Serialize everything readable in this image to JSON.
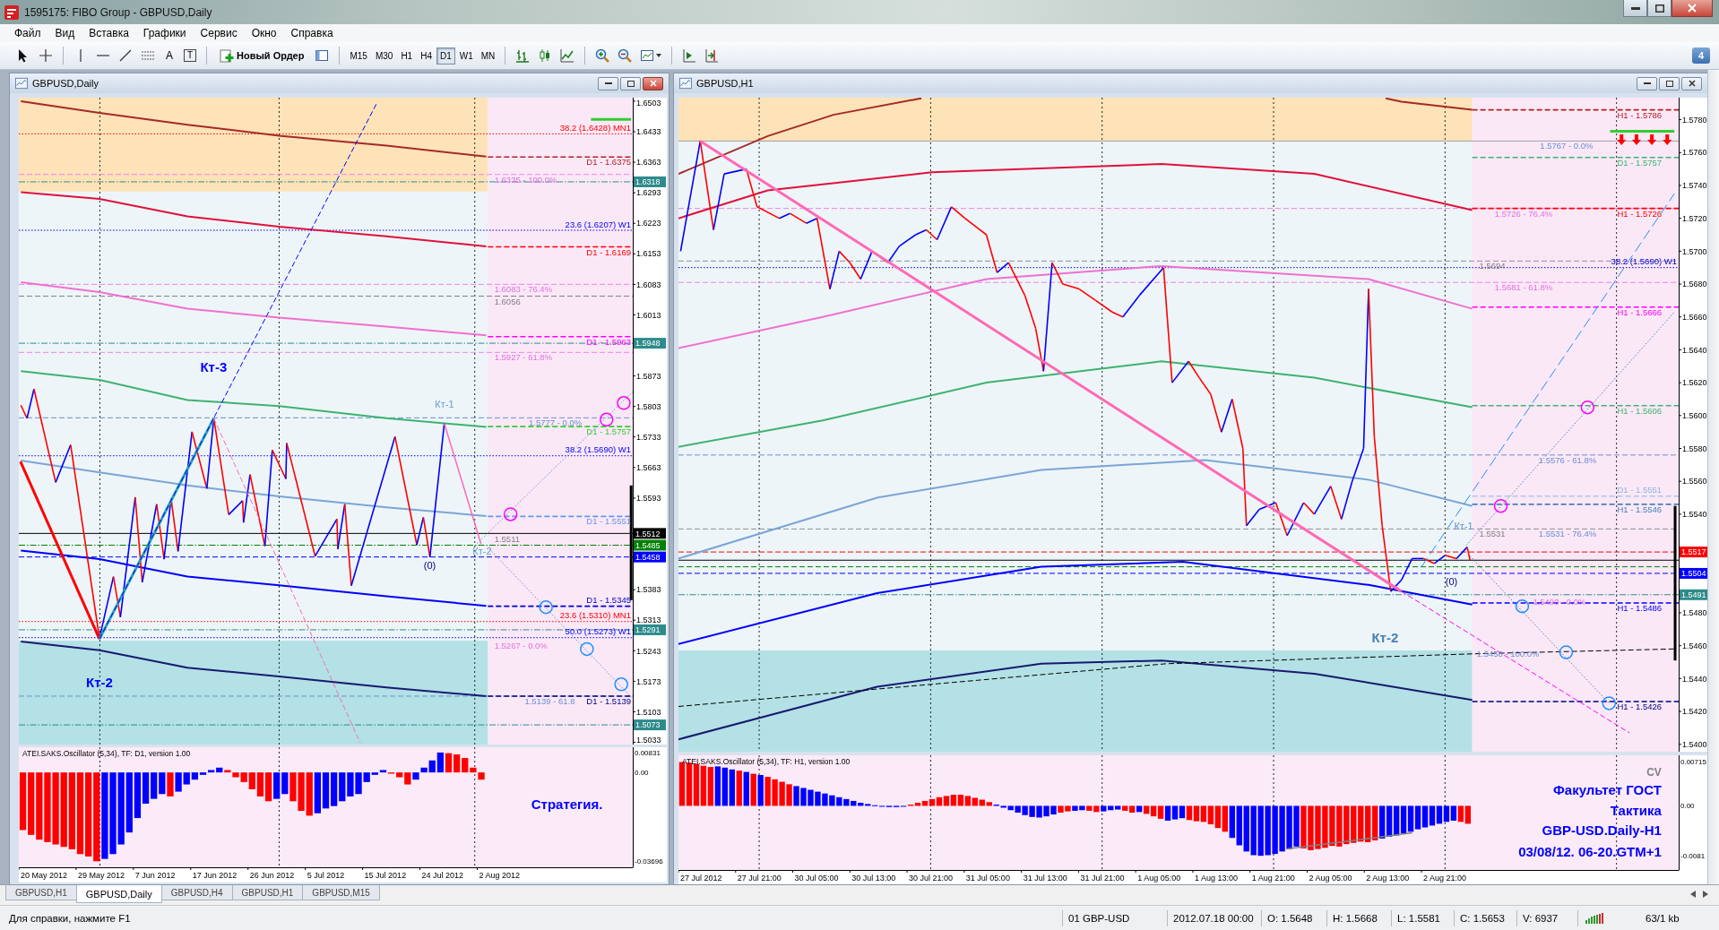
{
  "window": {
    "title": "1595175: FIBO Group - GBPUSD,Daily"
  },
  "menu": [
    "Файл",
    "Вид",
    "Вставка",
    "Графики",
    "Сервис",
    "Окно",
    "Справка"
  ],
  "toolbar": {
    "text_tools": [
      {
        "glyph": "A",
        "kind": "text"
      },
      {
        "glyph": "T",
        "kind": "label"
      }
    ],
    "new_order": "Новый Ордер",
    "timeframes": [
      {
        "label": "M15",
        "selected": false
      },
      {
        "label": "M30",
        "selected": false
      },
      {
        "label": "H1",
        "selected": false
      },
      {
        "label": "H4",
        "selected": false
      },
      {
        "label": "D1",
        "selected": true
      },
      {
        "label": "W1",
        "selected": false
      },
      {
        "label": "MN",
        "selected": false
      }
    ],
    "badge": "4"
  },
  "charts": [
    {
      "title": "GBPUSD,Daily",
      "active": true,
      "price_panel": {
        "axis_labels": [
          "1.6503",
          "1.6433",
          "1.6363",
          "1.6293",
          "1.6223",
          "1.6153",
          "1.6083",
          "1.6013",
          "1.5873",
          "1.5803",
          "1.5733",
          "1.5663",
          "1.5593",
          "1.5383",
          "1.5313",
          "1.5243",
          "1.5173",
          "1.5103",
          "1.5033"
        ],
        "price_tags": [
          "1.6318",
          "1.5948",
          "1.5512",
          "1.5485",
          "1.5458",
          "1.5291",
          "1.5073"
        ],
        "level_labels": [
          "38.2 (1.6428) MN1",
          "D1 - 1.6375",
          "1.6335 - 100.0%",
          "23.6 (1.6207) W1",
          "D1 - 1.6169",
          "1.6083 - 76.4%",
          "1.6056",
          "D1 - 1.5963",
          "1.5927 - 61.8%",
          "1.5777 - 0.0%",
          "D1 - 1.5757",
          "38.2 (1.5690) W1",
          "D1 - 1.5551",
          "1.5511",
          "D1 - 1.5345",
          "23.6 (1.5310) MN1",
          "50.0 (1.5273) W1",
          "1.5267 - 0.0%",
          "1.5139 - 61.8",
          "D1 - 1.5139"
        ],
        "point_labels": [
          "Кт-3",
          "Кт-2",
          "Кт-1",
          "(0)",
          "Кт-2"
        ]
      },
      "oscillator": {
        "title": "ATEI.SAKS.Oscillator (5,34), TF: D1, version 1.00",
        "axis_labels": [
          "0.00831",
          "0.00",
          "-0.03696"
        ],
        "notes": [
          "Стратегия."
        ]
      },
      "time_axis": [
        "20 May 2012",
        "29 May 2012",
        "7 Jun 2012",
        "17 Jun 2012",
        "26 Jun 2012",
        "5 Jul 2012",
        "15 Jul 2012",
        "24 Jul 2012",
        "2 Aug 2012"
      ]
    },
    {
      "title": "GBPUSD,H1",
      "active": false,
      "price_panel": {
        "axis_labels": [
          "1.5780",
          "1.5760",
          "1.5740",
          "1.5720",
          "1.5700",
          "1.5680",
          "1.5660",
          "1.5640",
          "1.5620",
          "1.5600",
          "1.5580",
          "1.5560",
          "1.5540",
          "1.5480",
          "1.5460",
          "1.5440",
          "1.5420",
          "1.5400"
        ],
        "price_tags": [
          "1.5517",
          "1.5504",
          "1.5491"
        ],
        "level_labels": [
          "H1 - 1.5786",
          "1.5767 - 0.0%",
          "D1 - 1.5757",
          "1.5726 - 76.4%",
          "H1 - 1.5726",
          "1.5694",
          "38.2 (1.5690) W1",
          "1.5681 - 61.8%",
          "H1 - 1.5666",
          "H1 - 1.5606",
          "1.5576 - 61.8%",
          "D1 - 1.5551",
          "H1 - 1.5546",
          "1.5531",
          "1.5531 - 76.4%",
          "1.5490 - 0.0%",
          "H1 - 1.5486",
          "1.5458 - 100.0%",
          "H1 - 1.5426"
        ],
        "point_labels": [
          "Кт-1",
          "(0)",
          "Кт-2"
        ]
      },
      "oscillator": {
        "title": "ATEI.SAKS.Oscillator (5,34), TF: H1, version 1.00",
        "axis_labels": [
          "0.00715",
          "0.00",
          "-0.0081"
        ],
        "notes": [
          "CV",
          "Факультет ГОСТ",
          "Тактика",
          "GBP-USD.Daily-H1",
          "03/08/12. 06-20.GTM+1"
        ]
      },
      "time_axis": [
        "27 Jul 2012",
        "27 Jul 21:00",
        "30 Jul 05:00",
        "30 Jul 13:00",
        "30 Jul 21:00",
        "31 Jul 05:00",
        "31 Jul 13:00",
        "31 Jul 21:00",
        "1 Aug 05:00",
        "1 Aug 13:00",
        "1 Aug 21:00",
        "2 Aug 05:00",
        "2 Aug 13:00",
        "2 Aug 21:00"
      ]
    }
  ],
  "tabs": [
    {
      "label": "GBPUSD,H1",
      "selected": false
    },
    {
      "label": "GBPUSD,Daily",
      "selected": true
    },
    {
      "label": "GBPUSD,H4",
      "selected": false
    },
    {
      "label": "GBPUSD,H1",
      "selected": false
    },
    {
      "label": "GBPUSD,M15",
      "selected": false
    }
  ],
  "status_bar": {
    "help": "Для справки, нажмите F1",
    "profile": "01 GBP-USD",
    "time": "2012.07.18 00:00",
    "open": "O: 1.5648",
    "high": "H: 1.5668",
    "low": "L: 1.5581",
    "close": "C: 1.5653",
    "volume": "V: 6937",
    "traffic": "63/1 kb"
  }
}
